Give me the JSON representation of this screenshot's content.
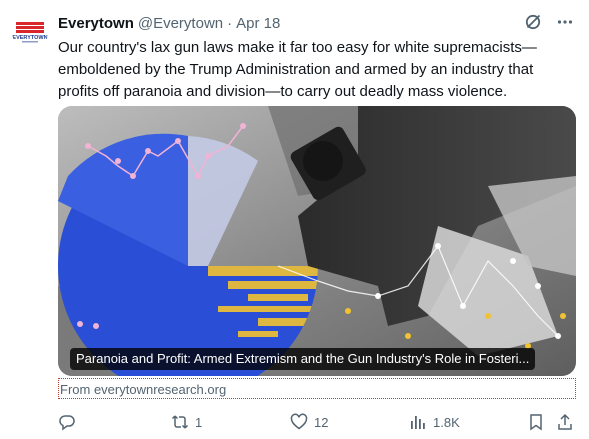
{
  "tweet": {
    "display_name": "Everytown",
    "handle": "@Everytown",
    "separator": "·",
    "date": "Apr 18",
    "avatar_text": "EVERYTOWN",
    "text": "Our country's lax gun laws make it far too easy for white supremacists—emboldened by the Trump Administration and armed by an industry that profits off paranoia and division—to carry out deadly mass violence.",
    "card": {
      "caption": "Paranoia and Profit: Armed Extremism and the Gun Industry's Role in Fosteri...",
      "source": "From everytownresearch.org"
    },
    "actions": {
      "replies": "",
      "retweets": "1",
      "likes": "12",
      "views": "1.8K"
    }
  },
  "icons": {
    "grok": "grok-icon",
    "more": "more-icon",
    "reply": "reply-icon",
    "retweet": "retweet-icon",
    "like": "like-icon",
    "views": "views-icon",
    "bookmark": "bookmark-icon",
    "share": "share-icon"
  },
  "colors": {
    "text": "#0f1419",
    "secondary": "#536471",
    "brand_red": "#d9262c",
    "brand_blue": "#1d3b8f",
    "card_blue": "#2a4fd6",
    "card_yellow": "#f2c230"
  }
}
